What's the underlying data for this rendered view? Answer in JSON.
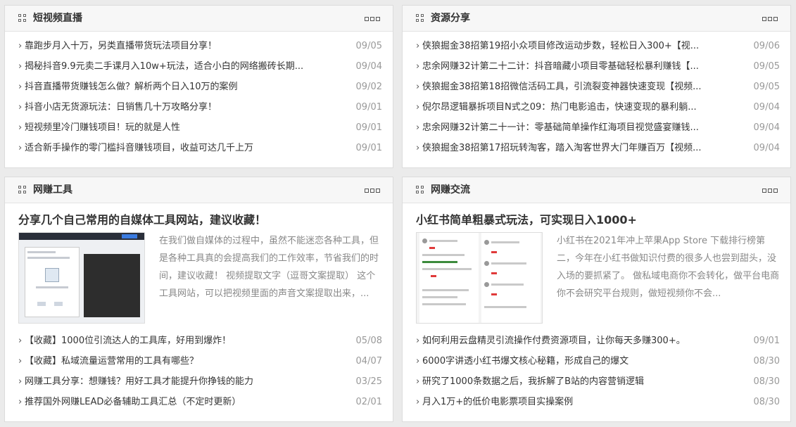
{
  "panels": [
    {
      "title": "短视频直播",
      "items": [
        {
          "text": "靠跑步月入十万，另类直播带货玩法项目分享！",
          "date": "09/05"
        },
        {
          "text": "揭秘抖音9.9元卖二手课月入10w+玩法，适合小白的网络搬砖长期...",
          "date": "09/04"
        },
        {
          "text": "抖音直播带货赚钱怎么做？解析两个日入10万的案例",
          "date": "09/02"
        },
        {
          "text": "抖音小店无货源玩法：日销售几十万攻略分享！",
          "date": "09/01"
        },
        {
          "text": "短视频里冷门赚钱项目！玩的就是人性",
          "date": "09/01"
        },
        {
          "text": "适合新手操作的零门槛抖音赚钱项目，收益可达几千上万",
          "date": "09/01"
        }
      ]
    },
    {
      "title": "资源分享",
      "items": [
        {
          "text": "侠狼掘金38招第19招小众项目修改运动步数，轻松日入300+【视...",
          "date": "09/06"
        },
        {
          "text": "忠余网赚32计第二十二计：抖音暗藏小项目零基础轻松暴利赚钱【...",
          "date": "09/05"
        },
        {
          "text": "侠狼掘金38招第18招微信活码工具，引流裂变神器快速变现【视频...",
          "date": "09/05"
        },
        {
          "text": "倪尔昂逻辑暴拆项目N式之09：热门电影追击，快速变现的暴利躺...",
          "date": "09/04"
        },
        {
          "text": "忠余网赚32计第二十一计：零基础简单操作红海项目视觉盛宴赚钱...",
          "date": "09/04"
        },
        {
          "text": "侠狼掘金38招第17招玩转淘客，踏入淘客世界大门年赚百万【视频...",
          "date": "09/04"
        }
      ]
    },
    {
      "title": "网赚工具",
      "featured": {
        "title": "分享几个自己常用的自媒体工具网站，建议收藏！",
        "desc": "在我们做自媒体的过程中，虽然不能迷恋各种工具，但是各种工具真的会提高我们的工作效率，节省我们的时间，建议收藏！ 视频提取文字（逗哥文案提取） 这个工具网站，可以把视频里面的声音文案提取出来，..."
      },
      "items": [
        {
          "text": "【收藏】1000位引流达人的工具库，好用到爆炸！",
          "date": "05/08"
        },
        {
          "text": "【收藏】私域流量运营常用的工具有哪些？",
          "date": "04/07"
        },
        {
          "text": "网赚工具分享：想赚钱？用好工具才能提升你挣钱的能力",
          "date": "03/25"
        },
        {
          "text": "推荐国外网赚LEAD必备辅助工具汇总（不定时更新）",
          "date": "02/01"
        }
      ]
    },
    {
      "title": "网赚交流",
      "featured": {
        "title": "小红书简单粗暴式玩法，可实现日入1000+",
        "desc": "小红书在2021年冲上苹果App Store 下载排行榜第二，今年在小红书做知识付费的很多人也尝到甜头，没入场的要抓紧了。 做私域电商你不会转化，做平台电商你不会研究平台规则，做短视频你不会..."
      },
      "items": [
        {
          "text": "如何利用云盘精灵引流操作付费资源项目，让你每天多赚300+。",
          "date": "09/01"
        },
        {
          "text": "6000字讲透小红书爆文核心秘籍，形成自己的爆文",
          "date": "08/30"
        },
        {
          "text": "研究了1000条数据之后，我拆解了B站的内容营销逻辑",
          "date": "08/30"
        },
        {
          "text": "月入1万+的低价电影票项目实操案例",
          "date": "08/30"
        }
      ]
    }
  ],
  "icons": {
    "chevron": "›",
    "header": "grid-icon",
    "more": "more-icon"
  }
}
